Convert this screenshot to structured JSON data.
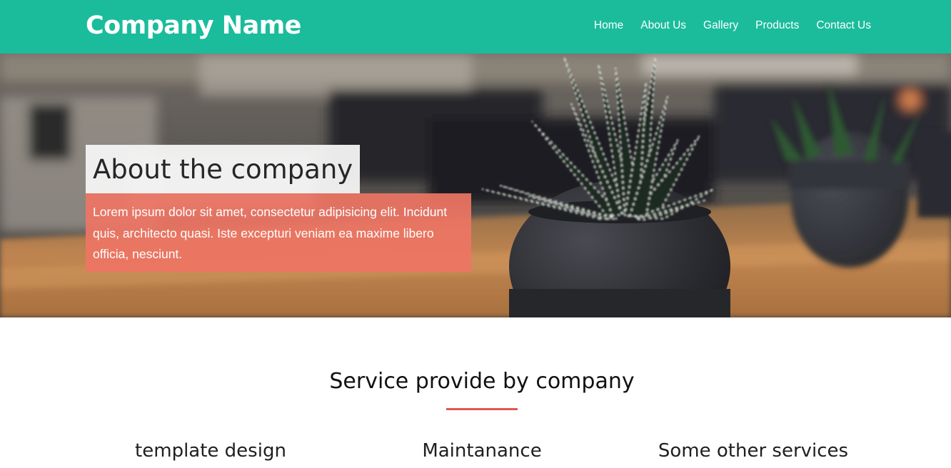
{
  "header": {
    "brand": "Company Name",
    "nav": [
      {
        "label": "Home"
      },
      {
        "label": "About Us"
      },
      {
        "label": "Gallery"
      },
      {
        "label": "Products"
      },
      {
        "label": "Contact Us"
      }
    ]
  },
  "hero": {
    "title": "About the company",
    "text": "Lorem ipsum dolor sit amet, consectetur adipisicing elit. Incidunt quis, architecto quasi. Iste excepturi veniam ea maxime libero officia, nesciunt."
  },
  "services": {
    "title": "Service provide by company",
    "items": [
      {
        "heading": "template design"
      },
      {
        "heading": "Maintanance"
      },
      {
        "heading": "Some other services"
      }
    ]
  },
  "colors": {
    "header_bg": "#1abc9c",
    "accent_red": "#e0574f",
    "hero_text_bg": "#ee7564"
  }
}
